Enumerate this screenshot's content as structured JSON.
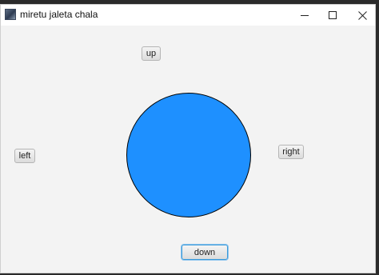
{
  "window": {
    "title": "miretu jaleta chala",
    "icon": "app-icon"
  },
  "controls": {
    "minimize_icon": "minimize-icon",
    "maximize_icon": "maximize-icon",
    "close_icon": "close-icon"
  },
  "buttons": {
    "up": "up",
    "left": "left",
    "right": "right",
    "down": "down"
  },
  "ball": {
    "fill": "#1e90ff",
    "stroke": "#000000"
  }
}
